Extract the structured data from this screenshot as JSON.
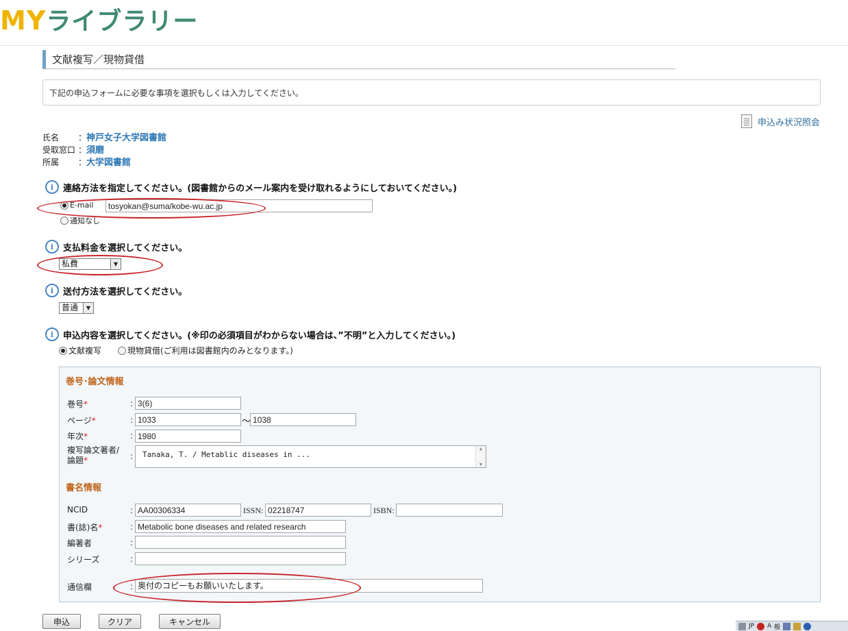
{
  "brand": {
    "logo_my": "MY",
    "logo_rest": "ライブラリー"
  },
  "section": {
    "title": "文献複写／現物貸借"
  },
  "instructions": "下記の申込フォームに必要な事項を選択もしくは入力してください。",
  "status_link": "申込み状況照会",
  "user": [
    {
      "label": "氏名",
      "colon": "：",
      "value": "神戸女子大学図書館"
    },
    {
      "label": "受取窓口",
      "colon": "：",
      "value": "須磨"
    },
    {
      "label": "所属",
      "colon": "：",
      "value": "大学図書館"
    }
  ],
  "contact": {
    "question": "連絡方法を指定してください。(図書館からのメール案内を受け取れるようにしておいてください。)",
    "email_label": "E-mail",
    "email_value": "tosyokan@suma/kobe-wu.ac.jp",
    "none_label": "通知なし"
  },
  "payment": {
    "question": "支払料金を選択してください。",
    "value": "私費"
  },
  "delivery": {
    "question": "送付方法を選択してください。",
    "value": "普通"
  },
  "request_type": {
    "question": "申込内容を選択してください。(※印の必須項目がわからない場合は、”不明”と入力してください。)",
    "option_copy": "文献複写",
    "option_loan": "現物貸借(ご利用は図書館内のみとなります。)"
  },
  "article": {
    "heading": "巻号･論文情報",
    "volume_label": "巻号",
    "volume_value": "3(6)",
    "page_label": "ページ",
    "page_from": "1033",
    "page_tilde": "～",
    "page_to": "1038",
    "year_label": "年次",
    "year_value": "1980",
    "author_label_1": "複写論文著者/",
    "author_label_2": "論題",
    "author_value": "Tanaka, T. / Metablic diseases in ...",
    "required_mark": "*",
    "colon": ":"
  },
  "book": {
    "heading": "書名情報",
    "ncid_label": "NCID",
    "ncid_value": "AA00306334",
    "issn_label": "ISSN:",
    "issn_value": "02218747",
    "isbn_label": "ISBN:",
    "isbn_value": "",
    "title_label": "書(誌)名",
    "title_value": "Metabolic bone diseases and related research",
    "editor_label": "編著者",
    "editor_value": "",
    "series_label": "シリーズ",
    "series_value": "",
    "message_label": "通信欄",
    "message_value": "奥付のコピーもお願いいたします。"
  },
  "buttons": {
    "submit": "申込",
    "clear": "クリア",
    "cancel": "キャンセル"
  },
  "taskbar": {
    "lang": "JP",
    "ime": "A",
    "mode": "般"
  },
  "colors": {
    "accent_blue": "#2e78b4",
    "heading_orange": "#c0651a",
    "annotation_red": "#c8262b",
    "logo_yellow": "#f0b400",
    "logo_green": "#3f8a70"
  }
}
